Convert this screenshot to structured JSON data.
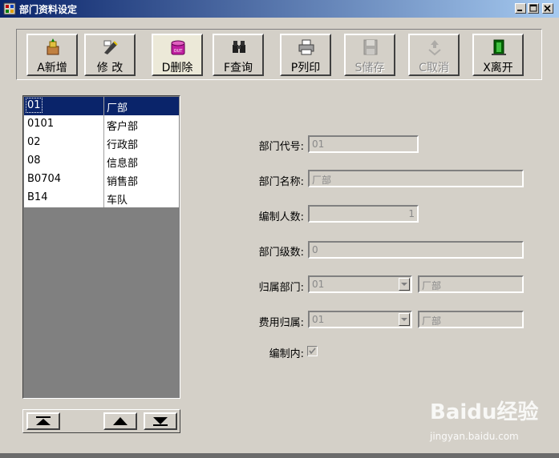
{
  "window": {
    "title": "部门资料设定"
  },
  "toolbar": {
    "buttons": [
      {
        "label": "A新增",
        "icon": "new-icon",
        "enabled": true
      },
      {
        "label": "修  改",
        "icon": "edit-icon",
        "enabled": true
      },
      {
        "label": "D删除",
        "icon": "delete-icon",
        "enabled": true
      },
      {
        "label": "F查询",
        "icon": "binoculars-icon",
        "enabled": true
      },
      {
        "label": "P列印",
        "icon": "printer-icon",
        "enabled": true
      },
      {
        "label": "S储存",
        "icon": "save-icon",
        "enabled": false
      },
      {
        "label": "C取消",
        "icon": "cancel-icon",
        "enabled": false
      },
      {
        "label": "X离开",
        "icon": "exit-icon",
        "enabled": true
      }
    ]
  },
  "list": {
    "rows": [
      {
        "code": "01",
        "name": "厂部"
      },
      {
        "code": "0101",
        "name": "客户部"
      },
      {
        "code": "02",
        "name": "行政部"
      },
      {
        "code": "08",
        "name": "信息部"
      },
      {
        "code": "B0704",
        "name": "销售部"
      },
      {
        "code": "B14",
        "name": "车队"
      }
    ]
  },
  "form": {
    "dept_code_label": "部门代号:",
    "dept_code_value": "01",
    "dept_name_label": "部门名称:",
    "dept_name_value": "厂部",
    "headcount_label": "编制人数:",
    "headcount_value": "1",
    "dept_level_label": "部门级数:",
    "dept_level_value": "0",
    "parent_label": "归属部门:",
    "parent_code": "01",
    "parent_name": "厂部",
    "cost_label": "费用归属:",
    "cost_code": "01",
    "cost_name": "厂部",
    "in_quota_label": "编制内:",
    "in_quota_checked": true
  },
  "watermark": {
    "text": "Baidu经验",
    "sub": "jingyan.baidu.com"
  },
  "colors": {
    "face": "#d4d0c8",
    "title_start": "#0a246a",
    "title_end": "#a6caf0",
    "selection": "#0a246a"
  }
}
